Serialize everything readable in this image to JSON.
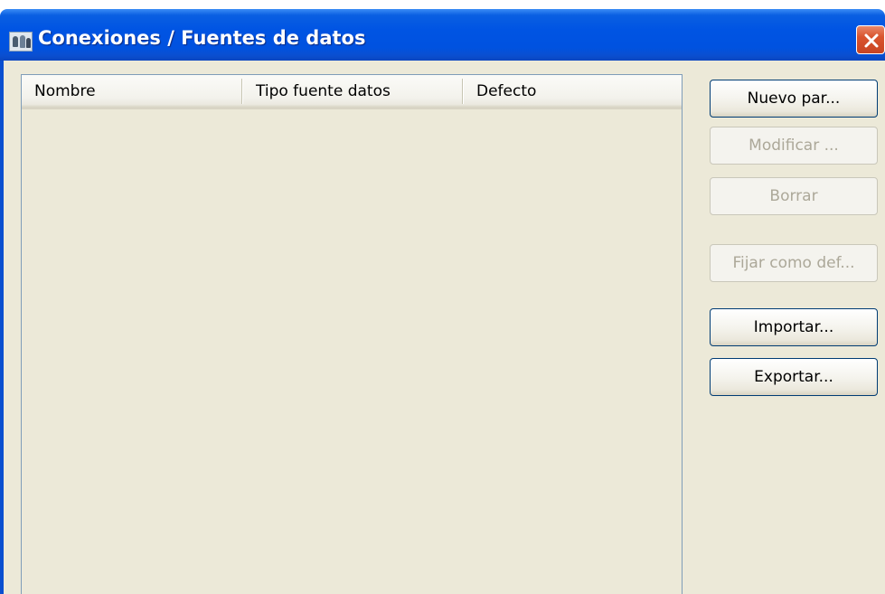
{
  "window": {
    "title": "Conexiones / Fuentes de datos",
    "title_bar_color": "#0054e3",
    "body_color": "#ece9d8",
    "close_button_color": "#d9542e"
  },
  "list": {
    "columns": [
      "Nombre",
      "Tipo fuente datos",
      "Defecto"
    ],
    "rows": []
  },
  "buttons": {
    "new": "Nuevo par...",
    "modify": "Modificar ...",
    "delete": "Borrar",
    "set_default": "Fijar como def...",
    "import": "Importar...",
    "export": "Exportar..."
  },
  "icons": {
    "title": "people-group-icon",
    "close": "close-icon"
  }
}
